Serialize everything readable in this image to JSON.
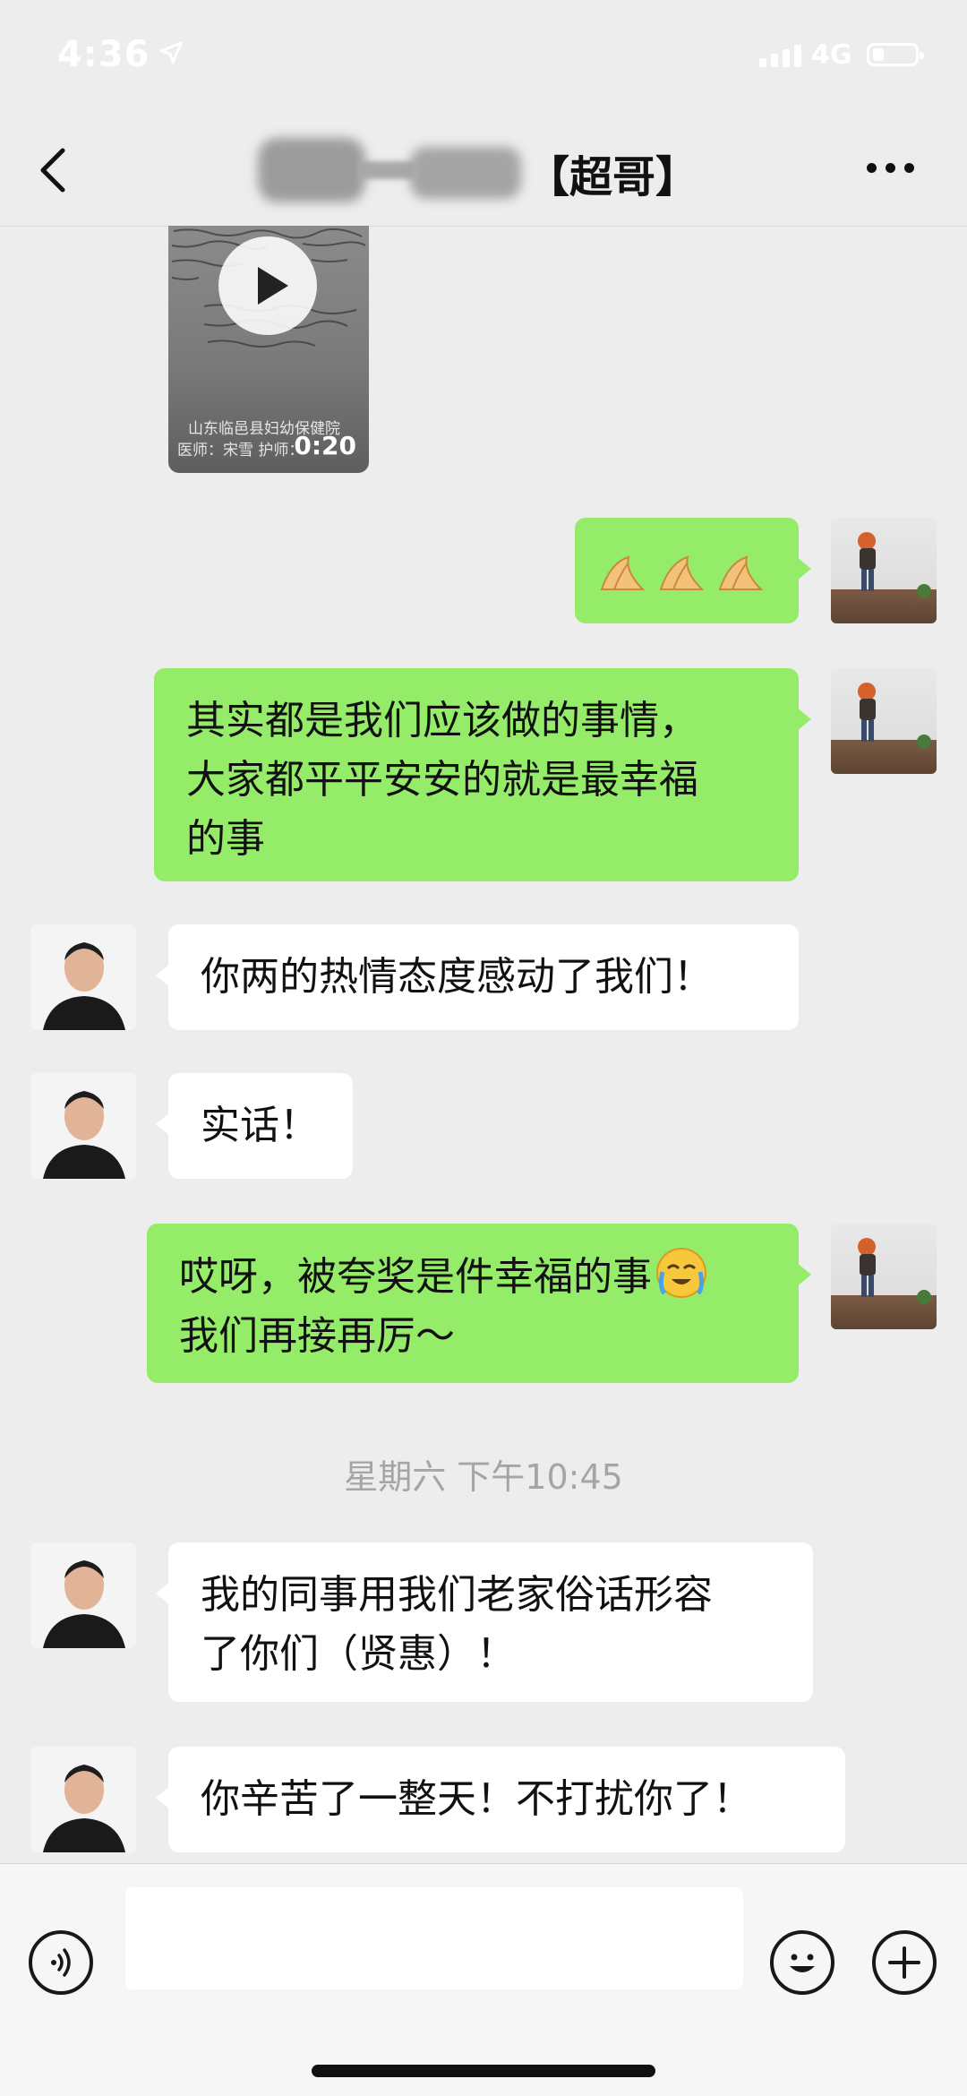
{
  "status_bar": {
    "time": "4:36",
    "network": "4G",
    "location_icon": "location-arrow-icon",
    "signal_icon": "signal-bars-icon",
    "battery_icon": "battery-icon"
  },
  "nav": {
    "title": "【超哥】",
    "back_icon": "chevron-left-icon",
    "more_icon": "more-dots-icon"
  },
  "video_message": {
    "duration": "0:20",
    "caption": "山东临邑县妇幼保健院",
    "caption2": "医师：宋雪  护师：",
    "play_icon": "play-icon"
  },
  "messages": [
    {
      "side": "me",
      "type": "emoji",
      "emoji": "folded-hands-icon ×3"
    },
    {
      "side": "me",
      "type": "text",
      "text": "其实都是我们应该做的事情，\n大家都平平安安的就是最幸福\n的事"
    },
    {
      "side": "them",
      "type": "text",
      "text": "你两的热情态度感动了我们！"
    },
    {
      "side": "them",
      "type": "text",
      "text": "实话！"
    },
    {
      "side": "me",
      "type": "text",
      "text": "哎呀，被夸奖是件幸福的事",
      "text2": "我们再接再厉～",
      "emoji": "loudly-crying-face-icon"
    },
    {
      "side": "them",
      "type": "text",
      "text": "我的同事用我们老家俗话形容\n了你们（贤惠）！"
    },
    {
      "side": "them",
      "type": "text",
      "text": "你辛苦了一整天！不打扰你了！"
    }
  ],
  "timestamp": "星期六 下午10:45",
  "input_bar": {
    "voice_icon": "voice-icon",
    "emoji_icon": "emoji-face-icon",
    "plus_icon": "plus-icon",
    "input_value": ""
  },
  "colors": {
    "background": "#ededed",
    "my_bubble": "#95ec69",
    "their_bubble": "#ffffff",
    "timestamp": "#a5a5a5"
  }
}
